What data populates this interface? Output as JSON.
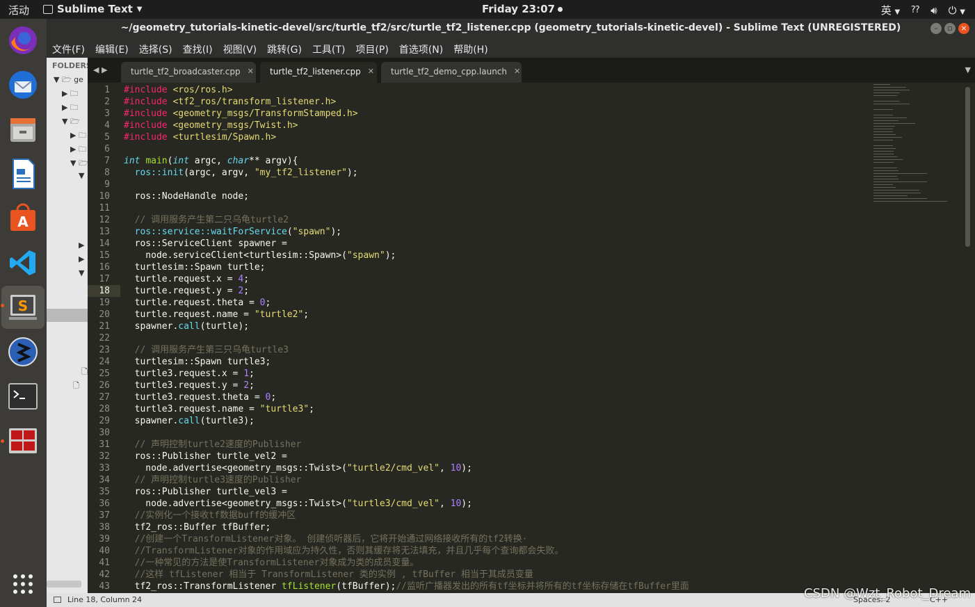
{
  "topbar": {
    "activities": "活动",
    "app_name": "Sublime Text",
    "clock": "Friday 23:07",
    "input_method": "英"
  },
  "window": {
    "title": "~/geometry_tutorials-kinetic-devel/src/turtle_tf2/src/turtle_tf2_listener.cpp (geometry_tutorials-kinetic-devel) - Sublime Text (UNREGISTERED)"
  },
  "menu": [
    "文件(F)",
    "编辑(E)",
    "选择(S)",
    "查找(I)",
    "视图(V)",
    "跳转(G)",
    "工具(T)",
    "项目(P)",
    "首选项(N)",
    "帮助(H)"
  ],
  "sidebar": {
    "header": "FOLDERS",
    "root": "ge"
  },
  "tabs": [
    {
      "label": "turtle_tf2_broadcaster.cpp",
      "active": false
    },
    {
      "label": "turtle_tf2_listener.cpp",
      "active": true
    },
    {
      "label": "turtle_tf2_demo_cpp.launch",
      "active": false
    }
  ],
  "editor": {
    "current_line": 18,
    "line_numbers": [
      "1",
      "2",
      "3",
      "4",
      "5",
      "6",
      "7",
      "8",
      "9",
      "10",
      "11",
      "12",
      "13",
      "14",
      "15",
      "16",
      "17",
      "18",
      "19",
      "20",
      "21",
      "22",
      "23",
      "24",
      "25",
      "26",
      "27",
      "28",
      "29",
      "30",
      "31",
      "32",
      "33",
      "34",
      "35",
      "36",
      "37",
      "38",
      "39",
      "40",
      "41",
      "42",
      "43"
    ],
    "lines": [
      {
        "t": [
          [
            "kw",
            "#include "
          ],
          [
            "str",
            "<ros/ros.h>"
          ]
        ]
      },
      {
        "t": [
          [
            "kw",
            "#include "
          ],
          [
            "str",
            "<tf2_ros/transform_listener.h>"
          ]
        ]
      },
      {
        "t": [
          [
            "kw",
            "#include "
          ],
          [
            "str",
            "<geometry_msgs/TransformStamped.h>"
          ]
        ]
      },
      {
        "t": [
          [
            "kw",
            "#include "
          ],
          [
            "str",
            "<geometry_msgs/Twist.h>"
          ]
        ]
      },
      {
        "t": [
          [
            "kw",
            "#include "
          ],
          [
            "str",
            "<turtlesim/Spawn.h>"
          ]
        ]
      },
      {
        "t": [
          [
            "",
            ""
          ]
        ]
      },
      {
        "t": [
          [
            "typ",
            "int"
          ],
          [
            "",
            " "
          ],
          [
            "fn",
            "main"
          ],
          [
            "",
            "("
          ],
          [
            "typ",
            "int"
          ],
          [
            "",
            " argc, "
          ],
          [
            "typ",
            "char"
          ],
          [
            "",
            "** argv){"
          ]
        ]
      },
      {
        "t": [
          [
            "",
            "  "
          ],
          [
            "ns",
            "ros::init"
          ],
          [
            "",
            "(argc, argv, "
          ],
          [
            "str",
            "\"my_tf2_listener\""
          ],
          [
            "",
            ");"
          ]
        ]
      },
      {
        "t": [
          [
            "",
            ""
          ]
        ]
      },
      {
        "t": [
          [
            "",
            "  ros::NodeHandle node;"
          ]
        ]
      },
      {
        "t": [
          [
            "",
            ""
          ]
        ]
      },
      {
        "t": [
          [
            "",
            "  "
          ],
          [
            "cm",
            "// 调用服务产生第二只乌龟turtle2"
          ]
        ]
      },
      {
        "t": [
          [
            "",
            "  "
          ],
          [
            "ns",
            "ros::service::waitForService"
          ],
          [
            "",
            "("
          ],
          [
            "str",
            "\"spawn\""
          ],
          [
            "",
            ");"
          ]
        ]
      },
      {
        "t": [
          [
            "",
            "  ros::ServiceClient spawner ="
          ]
        ]
      },
      {
        "t": [
          [
            "",
            "    node.serviceClient<turtlesim::Spawn>("
          ],
          [
            "str",
            "\"spawn\""
          ],
          [
            "",
            ");"
          ]
        ]
      },
      {
        "t": [
          [
            "",
            "  turtlesim::Spawn turtle;"
          ]
        ]
      },
      {
        "t": [
          [
            "",
            "  turtle.request.x = "
          ],
          [
            "num",
            "4"
          ],
          [
            "",
            ";"
          ]
        ]
      },
      {
        "t": [
          [
            "",
            "  turtle.request.y = "
          ],
          [
            "num",
            "2"
          ],
          [
            "",
            ";"
          ]
        ]
      },
      {
        "t": [
          [
            "",
            "  turtle.request.theta = "
          ],
          [
            "num",
            "0"
          ],
          [
            "",
            ";"
          ]
        ]
      },
      {
        "t": [
          [
            "",
            "  turtle.request.name = "
          ],
          [
            "str",
            "\"turtle2\""
          ],
          [
            "",
            ";"
          ]
        ]
      },
      {
        "t": [
          [
            "",
            "  spawner."
          ],
          [
            "ns",
            "call"
          ],
          [
            "",
            "(turtle);"
          ]
        ]
      },
      {
        "t": [
          [
            "",
            ""
          ]
        ]
      },
      {
        "t": [
          [
            "",
            "  "
          ],
          [
            "cm",
            "// 调用服务产生第三只乌龟turtle3"
          ]
        ]
      },
      {
        "t": [
          [
            "",
            "  turtlesim::Spawn turtle3;"
          ]
        ]
      },
      {
        "t": [
          [
            "",
            "  turtle3.request.x = "
          ],
          [
            "num",
            "1"
          ],
          [
            "",
            ";"
          ]
        ]
      },
      {
        "t": [
          [
            "",
            "  turtle3.request.y = "
          ],
          [
            "num",
            "2"
          ],
          [
            "",
            ";"
          ]
        ]
      },
      {
        "t": [
          [
            "",
            "  turtle3.request.theta = "
          ],
          [
            "num",
            "0"
          ],
          [
            "",
            ";"
          ]
        ]
      },
      {
        "t": [
          [
            "",
            "  turtle3.request.name = "
          ],
          [
            "str",
            "\"turtle3\""
          ],
          [
            "",
            ";"
          ]
        ]
      },
      {
        "t": [
          [
            "",
            "  spawner."
          ],
          [
            "ns",
            "call"
          ],
          [
            "",
            "(turtle3);"
          ]
        ]
      },
      {
        "t": [
          [
            "",
            ""
          ]
        ]
      },
      {
        "t": [
          [
            "",
            "  "
          ],
          [
            "cm",
            "// 声明控制turtle2速度的Publisher"
          ]
        ]
      },
      {
        "t": [
          [
            "",
            "  ros::Publisher turtle_vel2 ="
          ]
        ]
      },
      {
        "t": [
          [
            "",
            "    node.advertise<geometry_msgs::Twist>("
          ],
          [
            "str",
            "\"turtle2/cmd_vel\""
          ],
          [
            "",
            ", "
          ],
          [
            "num",
            "10"
          ],
          [
            "",
            ");"
          ]
        ]
      },
      {
        "t": [
          [
            "",
            "  "
          ],
          [
            "cm",
            "// 声明控制turtle3速度的Publisher"
          ]
        ]
      },
      {
        "t": [
          [
            "",
            "  ros::Publisher turtle_vel3 ="
          ]
        ]
      },
      {
        "t": [
          [
            "",
            "    node.advertise<geometry_msgs::Twist>("
          ],
          [
            "str",
            "\"turtle3/cmd_vel\""
          ],
          [
            "",
            ", "
          ],
          [
            "num",
            "10"
          ],
          [
            "",
            ");"
          ]
        ]
      },
      {
        "t": [
          [
            "",
            "  "
          ],
          [
            "cm",
            "//实例化一个接收tf数据buff的缓冲区"
          ]
        ]
      },
      {
        "t": [
          [
            "",
            "  tf2_ros::Buffer tfBuffer;"
          ]
        ]
      },
      {
        "t": [
          [
            "",
            "  "
          ],
          [
            "cm",
            "//创建一个TransformListener对象。 创建侦听器后，它将开始通过网络接收所有的tf2转换·"
          ]
        ]
      },
      {
        "t": [
          [
            "",
            "  "
          ],
          [
            "cm",
            "//TransformListener对象的作用域应为持久性，否则其缓存将无法填充，并且几乎每个查询都会失败。"
          ]
        ]
      },
      {
        "t": [
          [
            "",
            "  "
          ],
          [
            "cm",
            "//一种常见的方法是使TransformListener对象成为类的成员变量。"
          ]
        ]
      },
      {
        "t": [
          [
            "",
            "  "
          ],
          [
            "cm",
            "//这样 tfListener 相当于 TransformListener 类的实例 , tfBuffer 相当于其成员变量"
          ]
        ]
      },
      {
        "t": [
          [
            "",
            "  tf2_ros::TransformListener "
          ],
          [
            "fn",
            "tfListener"
          ],
          [
            "",
            "(tfBuffer);"
          ],
          [
            "cm",
            "//监听广播器发出的所有tf坐标并将所有的tf坐标存储在tfBuffer里面"
          ]
        ]
      }
    ]
  },
  "status": {
    "position": "Line 18, Column 24",
    "spaces": "Spaces: 2",
    "syntax": "C++"
  },
  "watermark": "CSDN @Wzt_Robot_Dream",
  "colors": {
    "accent": "#e95420",
    "editor_bg": "#272822"
  }
}
